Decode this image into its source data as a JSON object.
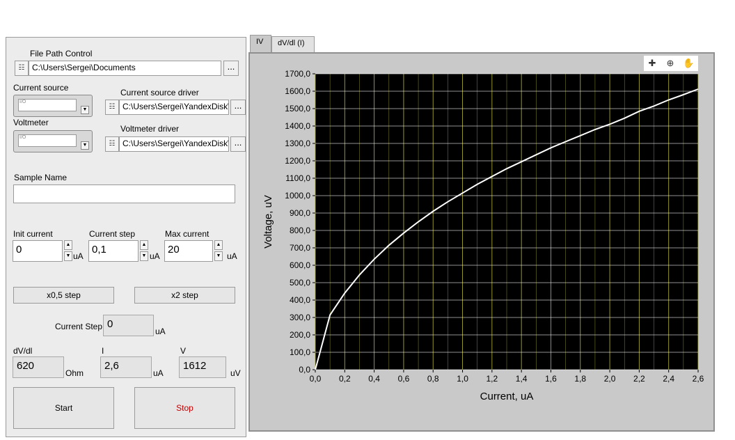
{
  "file_path": {
    "label": "File Path Control",
    "value": "C:\\Users\\Sergei\\Documents",
    "browse": "..."
  },
  "current_source": {
    "label": "Current source",
    "visa_hint": "I/O"
  },
  "voltmeter": {
    "label": "Voltmeter",
    "visa_hint": "I/O"
  },
  "current_source_driver": {
    "label": "Current source driver",
    "value": "C:\\Users\\Sergei\\YandexDisk\\",
    "browse": "..."
  },
  "voltmeter_driver": {
    "label": "Voltmeter driver",
    "value": "C:\\Users\\Sergei\\YandexDisk\\",
    "browse": "..."
  },
  "sample_name": {
    "label": "Sample Name",
    "value": ""
  },
  "init_current": {
    "label": "Init current",
    "value": "0",
    "unit": "uA"
  },
  "current_step": {
    "label": "Current step",
    "value": "0,1",
    "unit": "uA"
  },
  "max_current": {
    "label": "Max current",
    "value": "20",
    "unit": "uA"
  },
  "half_step_button": "x0,5 step",
  "double_step_button": "x2 step",
  "current_step_indicator": {
    "label": "Current Step",
    "value": "0",
    "unit": "uA"
  },
  "dvdl": {
    "label": "dV/dl",
    "value": "620",
    "unit": "Ohm"
  },
  "i": {
    "label": "I",
    "value": "2,6",
    "unit": "uA"
  },
  "v": {
    "label": "V",
    "value": "1612",
    "unit": "uV"
  },
  "start_button": "Start",
  "stop_button": "Stop",
  "tabs": [
    {
      "label": "IV",
      "active": true
    },
    {
      "label": "dV/dl (I)",
      "active": false
    }
  ],
  "palette_icons": [
    "cursor-move-icon",
    "zoom-icon",
    "pan-hand-icon"
  ],
  "colors": {
    "plot_bg": "#000000",
    "grid": "#b8b832",
    "curve": "#ffffff",
    "stop_text": "#c00000"
  },
  "chart_data": {
    "type": "line",
    "xlabel": "Current, uA",
    "ylabel": "Voltage, uV",
    "xlim": [
      0,
      2.6
    ],
    "ylim": [
      0,
      1700
    ],
    "x_ticks": [
      "0,0",
      "0,2",
      "0,4",
      "0,6",
      "0,8",
      "1,0",
      "1,2",
      "1,4",
      "1,6",
      "1,8",
      "2,0",
      "2,2",
      "2,4",
      "2,6"
    ],
    "y_ticks": [
      "0,0",
      "100,0",
      "200,0",
      "300,0",
      "400,0",
      "500,0",
      "600,0",
      "700,0",
      "800,0",
      "900,0",
      "1000,0",
      "1100,0",
      "1200,0",
      "1300,0",
      "1400,0",
      "1500,0",
      "1600,0",
      "1700,0"
    ],
    "grid": true,
    "series": [
      {
        "x": [
          0,
          0.1,
          0.2,
          0.3,
          0.4,
          0.5,
          0.6,
          0.7,
          0.8,
          0.9,
          1.0,
          1.1,
          1.2,
          1.3,
          1.4,
          1.5,
          1.6,
          1.7,
          1.8,
          1.9,
          2.0,
          2.1,
          2.2,
          2.3,
          2.4,
          2.5,
          2.6
        ],
        "y": [
          0,
          315,
          440,
          545,
          635,
          715,
          785,
          850,
          910,
          965,
          1015,
          1065,
          1110,
          1155,
          1195,
          1235,
          1275,
          1310,
          1345,
          1380,
          1410,
          1445,
          1485,
          1515,
          1550,
          1580,
          1612
        ]
      }
    ]
  }
}
